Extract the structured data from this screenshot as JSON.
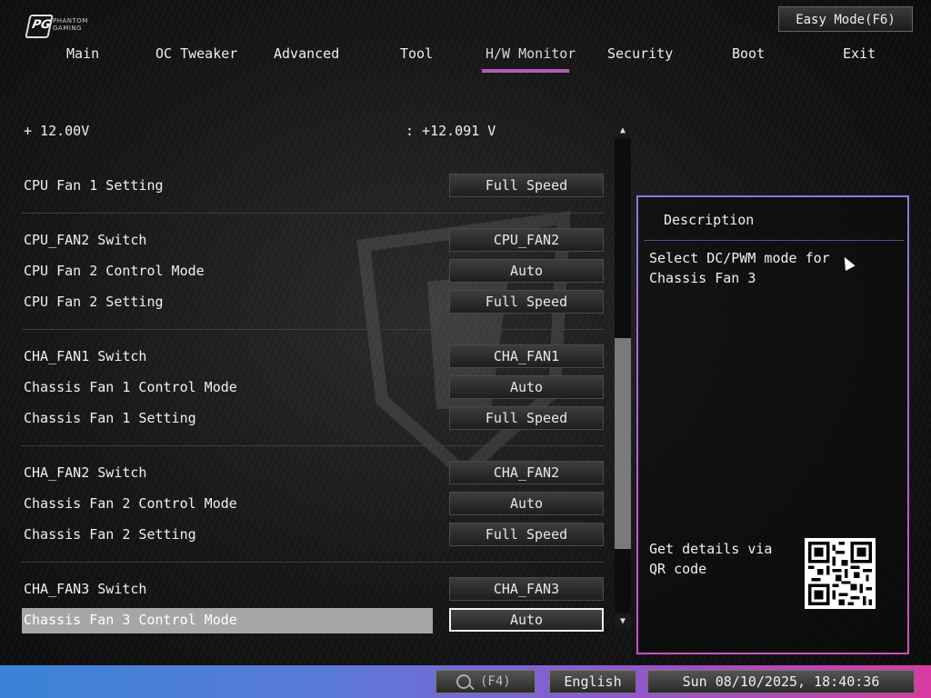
{
  "brand": {
    "logo_text": "PHANTOM GAMING",
    "logo_letter": "PG"
  },
  "header": {
    "easy_mode_label": "Easy Mode(F6)"
  },
  "nav": {
    "items": [
      {
        "label": "Main"
      },
      {
        "label": "OC Tweaker"
      },
      {
        "label": "Advanced"
      },
      {
        "label": "Tool"
      },
      {
        "label": "H/W Monitor",
        "active": true
      },
      {
        "label": "Security"
      },
      {
        "label": "Boot"
      },
      {
        "label": "Exit"
      }
    ]
  },
  "settings": {
    "voltage": {
      "label": "+ 12.00V",
      "value": ": +12.091 V"
    },
    "rows": [
      {
        "label": "CPU Fan 1 Setting",
        "value": "Full Speed"
      },
      {
        "label": "CPU_FAN2 Switch",
        "value": "CPU_FAN2"
      },
      {
        "label": "CPU Fan 2 Control Mode",
        "value": "Auto"
      },
      {
        "label": "CPU Fan 2 Setting",
        "value": "Full Speed"
      },
      {
        "label": "CHA_FAN1 Switch",
        "value": "CHA_FAN1"
      },
      {
        "label": "Chassis Fan 1 Control Mode",
        "value": "Auto"
      },
      {
        "label": "Chassis Fan 1 Setting",
        "value": "Full Speed"
      },
      {
        "label": "CHA_FAN2 Switch",
        "value": "CHA_FAN2"
      },
      {
        "label": "Chassis Fan 2 Control Mode",
        "value": "Auto"
      },
      {
        "label": "Chassis Fan 2 Setting",
        "value": "Full Speed"
      },
      {
        "label": "CHA_FAN3 Switch",
        "value": "CHA_FAN3"
      },
      {
        "label": "Chassis Fan 3 Control Mode",
        "value": "Auto",
        "selected": true
      }
    ]
  },
  "description": {
    "title": "Description",
    "text": "Select DC/PWM mode for Chassis Fan 3",
    "qr_label": "Get details via QR code"
  },
  "footer": {
    "search_key": "(F4)",
    "language": "English",
    "datetime": "Sun 08/10/2025, 18:40:36"
  },
  "colors": {
    "accent": "#b45ab4",
    "selected_row": "#a6a6a6",
    "footer_start": "#3a83d6",
    "footer_end": "#d83aa0"
  }
}
